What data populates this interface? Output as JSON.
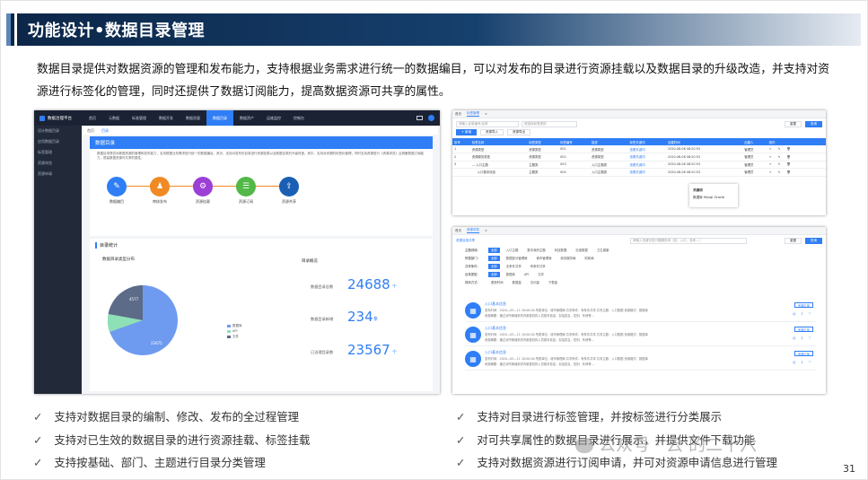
{
  "title": "功能设计•数据目录管理",
  "intro": "数据目录提供对数据资源的管理和发布能力，支持根据业务需求进行统一的数据编目，可以对发布的目录进行资源挂载以及数据目录的升级改造，并支持对资源进行标签化的管理，同时还提供了数据订阅能力，提高数据资源可共享的属性。",
  "features_left": [
    "支持对数据目录的编制、修改、发布的全过程管理",
    "支持对已生效的数据目录的进行资源挂载、标签挂载",
    "支持按基础、部门、主题进行目录分类管理"
  ],
  "features_right": [
    "支持对目录进行标签管理，并按标签进行分类展示",
    "对可共享属性的数据目录进行展示，并提供文件下载功能",
    "支持对数据资源进行订阅申请，并可对资源申请信息进行管理"
  ],
  "check": "✓",
  "watermark": "公众号 · 云  的二十六",
  "page_number": "31",
  "shot1": {
    "logo": "数据治理平台",
    "nav": [
      "首页",
      "元数据",
      "标准管理",
      "数据开发",
      "数据质量",
      "数据目录",
      "数据资产",
      "运维监控",
      "控制台"
    ],
    "sidebar": [
      "设计数据目录",
      "应用数据目录",
      "标签管理",
      "资源浏览",
      "资源申请"
    ],
    "tabs": [
      "首页",
      "目录"
    ],
    "card_title": "数据目录",
    "card_desc": "数据目录提供对数据资源的管理和发布能力，支持根据业务需求进行统一的数据编目。其次，支持对发布的目录进行资源挂载以及数据目录的升级改造，其中，支持对资源的标签化管理，同时支持资源进行《资源浏览》且具备数据订阅能力，提高数据资源可共享的属性。",
    "steps": [
      "数据编目",
      "审核发布",
      "资源挂载",
      "资源订阅",
      "资源共享"
    ],
    "stats_title": "目录统计",
    "pie_title": "数据目录类型分布",
    "pie_labels": [
      "4577",
      "23675"
    ],
    "legend": [
      "数据库",
      "API",
      "文件"
    ],
    "overview_title": "目录概览",
    "stats": [
      {
        "label": "数据目录总数",
        "value": "24688",
        "unit": "个"
      },
      {
        "label": "数据目录新增",
        "value": "234",
        "unit": "条"
      },
      {
        "label": "已治理目录数",
        "value": "23567",
        "unit": "个"
      }
    ]
  },
  "shot2": {
    "tabs": [
      "首页",
      "标签管理"
    ],
    "search_placeholder": "请输入目录编号/名称",
    "select_placeholder": "请选择标签类别",
    "btn_reset": "重置",
    "btn_search": "查询",
    "btn_add": "+ 新增",
    "btn_import": "资源导入",
    "btn_export": "资源导出",
    "columns": [
      "序号",
      "标签名称",
      "标签类型",
      "标签编号",
      "描述",
      "标签关键词",
      "创建时间",
      "创建人",
      "操作"
    ],
    "rows": [
      [
        "1",
        "资源类型",
        "资源类型",
        "001",
        "资源类型",
        "查看关键词",
        "2020-08-06 08:20:53",
        "管理员"
      ],
      [
        "2",
        "资源服务类型",
        "资源类型",
        "002",
        "资源类型",
        "查看关键词",
        "2020-08-06 08:20:53",
        "管理员"
      ],
      [
        "3",
        "— 入口主题",
        "主题类",
        "003",
        "入口主题类",
        "查看关键词",
        "2020-08-06 08:20:53",
        "管理员"
      ],
      [
        "",
        "入口基本信息",
        "主题类",
        "004",
        "入口主题类",
        "查看关键词",
        "2020-08-06 08:20:53",
        "管理员"
      ]
    ],
    "ops": "+ ✎ 🗑",
    "popup_title": "关键词",
    "popup_value": "数据库 Mysql Oracle"
  },
  "shot3": {
    "tabs": [
      "首页",
      "资源浏览"
    ],
    "breadcrumb": "资源目录共享",
    "search_placeholder": "请输入关键字进行模糊查询（如：入口、名称...）",
    "btn_reset": "重置",
    "btn_search": "查询",
    "filters": [
      {
        "label": "主题领域：",
        "tags": [
          "全部",
          "入口主题",
          "数字政府主题",
          "科技数据",
          "社保数据",
          "卫生健康"
        ]
      },
      {
        "label": "所属部门：",
        "tags": [
          "全部",
          "数据部分管理局",
          "城市管理局",
          "政务服务局",
          "财政局"
        ]
      },
      {
        "label": "共享条件：",
        "tags": [
          "全部",
          "无条件共享",
          "有条件共享"
        ]
      },
      {
        "label": "目录类型：",
        "tags": [
          "全部",
          "数据库",
          "API",
          "文件"
        ]
      }
    ],
    "sort_label": "排序方式：",
    "sort": [
      "更新时间",
      "数据量",
      "访问量",
      "下载量"
    ],
    "results": [
      {
        "title": "入口基本信息",
        "meta": "发布时间：2020—05—11 18:00:00   所属单位：城市管理局   共享条件：有条件共享   共享主题：入口数据   资源格式：数据库",
        "desc": "资源摘要：通过对所管辖机构内家庭机构入员基本信息，包括姓名、性别、年龄等...",
        "btn": "资源订阅"
      },
      {
        "title": "入口基本信息",
        "meta": "发布时间：2020—05—11 18:00:00   所属单位：城市管理局   共享条件：有条件共享   共享主题：入口数据   资源格式：数据库",
        "desc": "资源摘要：通过对所管辖机构内家庭机构入员基本信息，包括姓名、性别、年龄等...",
        "btn": "资源订阅"
      },
      {
        "title": "入口基本信息",
        "meta": "发布时间：2020—05—11 18:00:00   所属单位：城市管理局   共享条件：有条件共享   共享主题：入口数据   资源格式：数据库",
        "desc": "资源摘要：通过对所管辖机构内家庭机构入员基本信息，包括姓名、性别、年龄等...",
        "btn": "资源订阅"
      }
    ],
    "result_icons": "◎ ⇩ ♡"
  }
}
